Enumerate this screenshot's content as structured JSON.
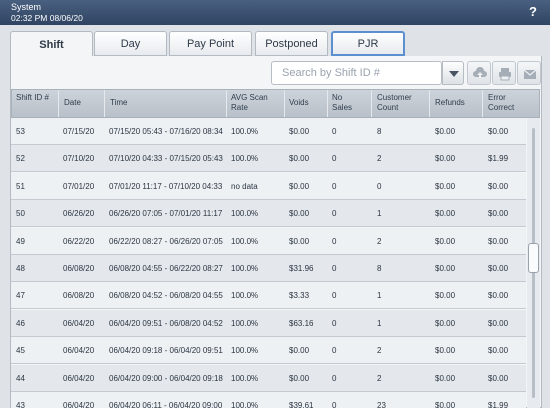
{
  "titlebar": {
    "app": "System",
    "datetime": "02:32 PM 08/06/20",
    "help": "?"
  },
  "tabs": [
    "Shift",
    "Day",
    "Pay Point",
    "Postponed",
    "PJR"
  ],
  "search": {
    "placeholder": "Search by Shift ID #"
  },
  "columns": [
    "Shift ID #",
    "Date",
    "Time",
    "AVG Scan Rate",
    "Voids",
    "No Sales",
    "Customer Count",
    "Refunds",
    "Error Correct"
  ],
  "rows": [
    [
      "53",
      "07/15/20",
      "07/15/20 05:43 - 07/16/20 08:34",
      "100.0%",
      "$0.00",
      "0",
      "8",
      "$0.00",
      "$0.00"
    ],
    [
      "52",
      "07/10/20",
      "07/10/20 04:33 - 07/15/20 05:43",
      "100.0%",
      "$0.00",
      "0",
      "2",
      "$0.00",
      "$1.99"
    ],
    [
      "51",
      "07/01/20",
      "07/01/20 11:17 - 07/10/20 04:33",
      "no data",
      "$0.00",
      "0",
      "0",
      "$0.00",
      "$0.00"
    ],
    [
      "50",
      "06/26/20",
      "06/26/20 07:05 - 07/01/20 11:17",
      "100.0%",
      "$0.00",
      "0",
      "1",
      "$0.00",
      "$0.00"
    ],
    [
      "49",
      "06/22/20",
      "06/22/20 08:27 - 06/26/20 07:05",
      "100.0%",
      "$0.00",
      "0",
      "2",
      "$0.00",
      "$0.00"
    ],
    [
      "48",
      "06/08/20",
      "06/08/20 04:55 - 06/22/20 08:27",
      "100.0%",
      "$31.96",
      "0",
      "8",
      "$0.00",
      "$0.00"
    ],
    [
      "47",
      "06/08/20",
      "06/08/20 04:52 - 06/08/20 04:55",
      "100.0%",
      "$3.33",
      "0",
      "1",
      "$0.00",
      "$0.00"
    ],
    [
      "46",
      "06/04/20",
      "06/04/20 09:51 - 06/08/20 04:52",
      "100.0%",
      "$63.16",
      "0",
      "1",
      "$0.00",
      "$0.00"
    ],
    [
      "45",
      "06/04/20",
      "06/04/20 09:18 - 06/04/20 09:51",
      "100.0%",
      "$0.00",
      "0",
      "2",
      "$0.00",
      "$0.00"
    ],
    [
      "44",
      "06/04/20",
      "06/04/20 09:00 - 06/04/20 09:18",
      "100.0%",
      "$0.00",
      "0",
      "2",
      "$0.00",
      "$0.00"
    ],
    [
      "43",
      "06/04/20",
      "06/04/20 06:11 - 06/04/20 09:00",
      "100.0%",
      "$39.61",
      "0",
      "23",
      "$0.00",
      "$1.99"
    ]
  ]
}
